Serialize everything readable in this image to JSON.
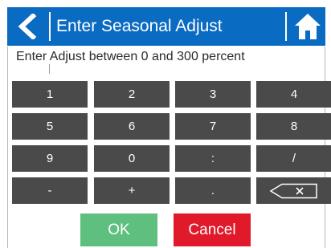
{
  "header": {
    "title": "Enter Seasonal Adjust",
    "back_icon": "chevron-left-icon",
    "home_icon": "home-icon",
    "bg_color": "#0a6bc2"
  },
  "instruction": "Enter Adjust between 0 and 300 percent",
  "keypad": {
    "key_color": "#4a4a4a",
    "rows": [
      [
        "1",
        "2",
        "3",
        "4"
      ],
      [
        "5",
        "6",
        "7",
        "8"
      ],
      [
        "9",
        "0",
        ":",
        "/"
      ],
      [
        "-",
        "+",
        ".",
        ""
      ]
    ],
    "backspace_icon": "backspace-icon"
  },
  "actions": {
    "ok_label": "OK",
    "ok_color": "#5fbf7e",
    "cancel_label": "Cancel",
    "cancel_color": "#e01a2a"
  }
}
